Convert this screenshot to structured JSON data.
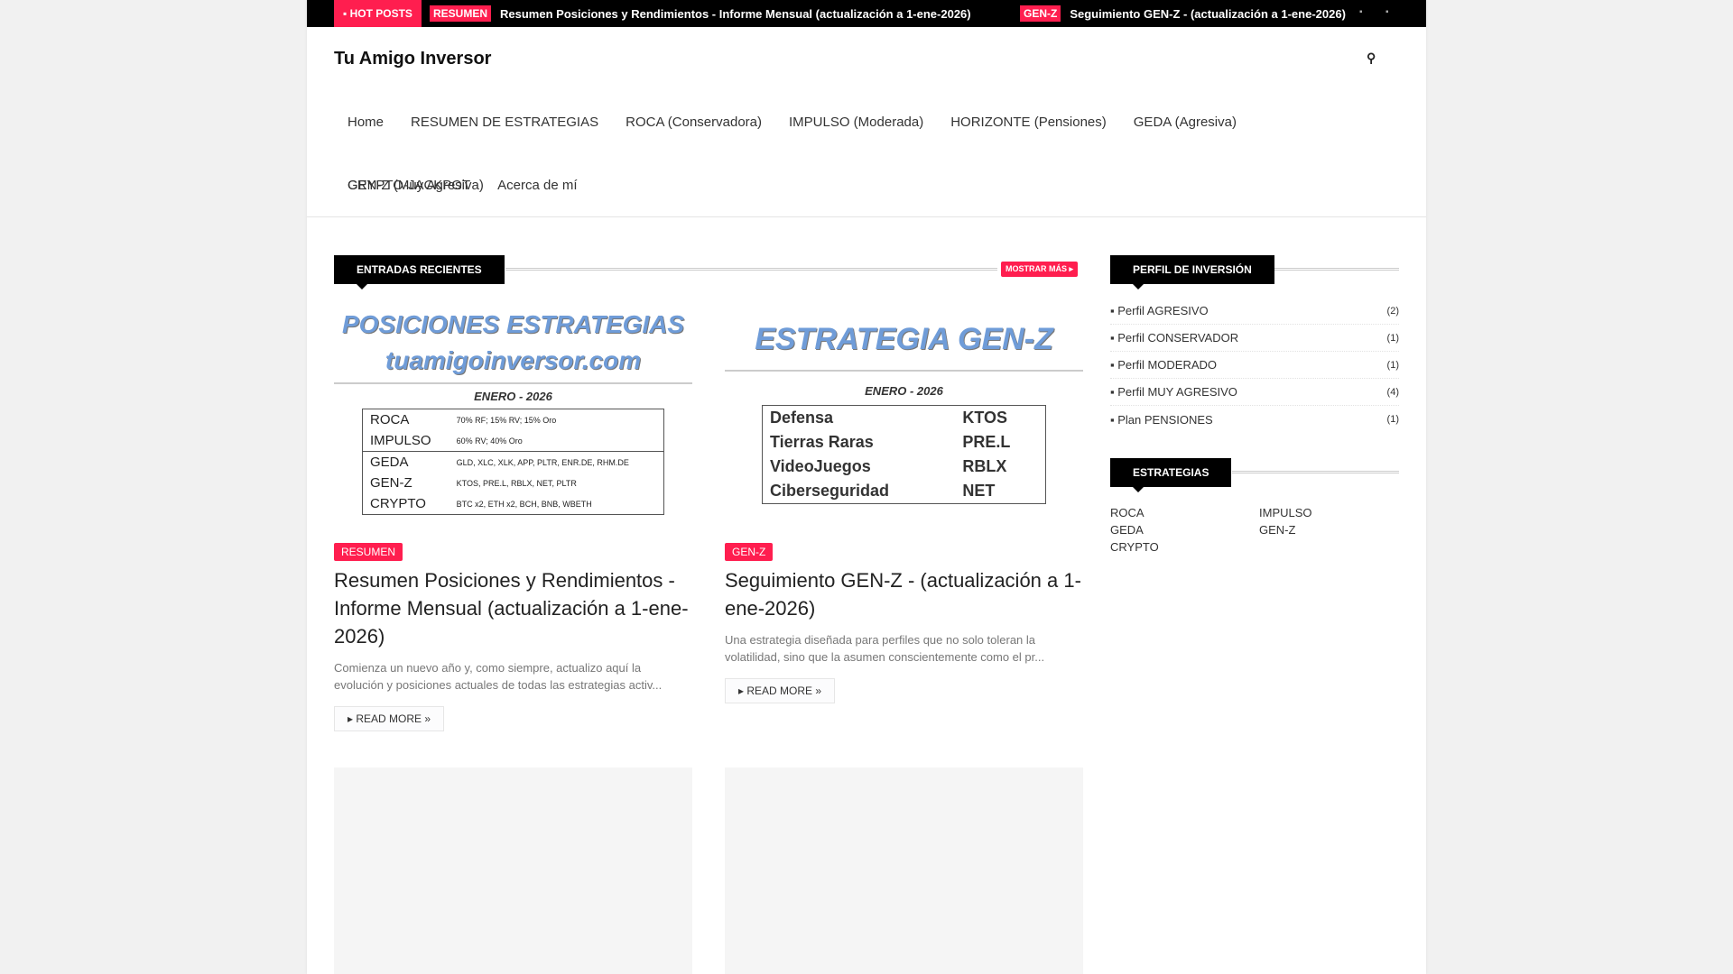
{
  "topbar": {
    "hot_label": "HOT POSTS",
    "ticker": [
      {
        "tag": "RESUMEN",
        "title": "Resumen Posiciones y Rendimientos - Informe Mensual (actualización a 1-ene-2026)"
      },
      {
        "tag": "GEN-Z",
        "title": "Seguimiento GEN-Z - (actualización a 1-ene-2026)"
      }
    ]
  },
  "header": {
    "logo": "Tu Amigo Inversor"
  },
  "nav": [
    "Home",
    "RESUMEN DE ESTRATEGIAS",
    "ROCA (Conservadora)",
    "IMPULSO (Moderada)",
    "HORIZONTE (Pensiones)",
    "GEDA (Agresiva)",
    "GEN-Z (Muy Agresiva)",
    "CRYPTO-JACKPOT",
    "Acerca de mí"
  ],
  "recent": {
    "title": "ENTRADAS RECIENTES",
    "more": "MOSTRAR MÁS",
    "posts": [
      {
        "tag": "RESUMEN",
        "title": "Resumen Posiciones y Rendimientos - Informe Mensual (actualización a 1-ene-2026)",
        "excerpt": "Comienza un nuevo año y, como siempre, actualizo aquí la evolución y posiciones actuales de todas las estrategias activ...",
        "read_more": "READ MORE »",
        "image": {
          "h1": "POSICIONES ESTRATEGIAS",
          "h2": "tuamigoinversor.com",
          "month": "ENERO - 2026",
          "rows": [
            [
              "ROCA",
              "70% RF; 15% RV; 15% Oro"
            ],
            [
              "IMPULSO",
              "60% RV; 40% Oro"
            ],
            [
              "GEDA",
              "GLD, XLC, XLK, APP, PLTR, ENR.DE, RHM.DE"
            ],
            [
              "GEN-Z",
              "KTOS, PRE.L, RBLX, NET, PLTR"
            ],
            [
              "CRYPTO",
              "BTC x2, ETH x2, BCH, BNB, WBETH"
            ]
          ]
        }
      },
      {
        "tag": "GEN-Z",
        "title": "Seguimiento GEN-Z - (actualización a 1-ene-2026)",
        "excerpt": "Una estrategia diseñada para perfiles que no solo toleran la volatilidad, sino que la asumen conscientemente como el pr...",
        "read_more": "READ MORE »",
        "image": {
          "h1": "ESTRATEGIA GEN-Z",
          "month": "ENERO - 2026",
          "rows": [
            [
              "Defensa",
              "KTOS"
            ],
            [
              "Tierras Raras",
              "PRE.L"
            ],
            [
              "VideoJuegos",
              "RBLX"
            ],
            [
              "Ciberseguridad",
              "NET"
            ]
          ]
        }
      }
    ]
  },
  "sidebar": {
    "profile_title": "PERFIL DE INVERSIÓN",
    "profiles": [
      {
        "label": "Perfil AGRESIVO",
        "count": "(2)"
      },
      {
        "label": "Perfil CONSERVADOR",
        "count": "(1)"
      },
      {
        "label": "Perfil MODERADO",
        "count": "(1)"
      },
      {
        "label": "Perfil MUY AGRESIVO",
        "count": "(4)"
      },
      {
        "label": "Plan PENSIONES",
        "count": "(1)"
      }
    ],
    "strat_title": "ESTRATEGIAS",
    "strategies": [
      "ROCA",
      "IMPULSO",
      "GEDA",
      "GEN-Z",
      "CRYPTO"
    ]
  }
}
